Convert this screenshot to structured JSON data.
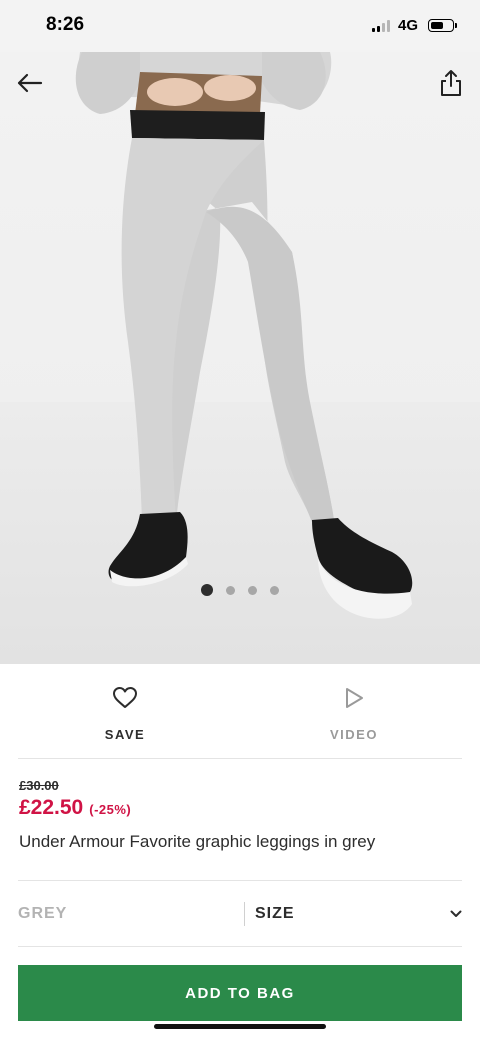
{
  "status_bar": {
    "time": "8:26",
    "network": "4G",
    "signal_bars_active": 2,
    "battery_level": 0.65
  },
  "hero": {
    "image_alt": "",
    "dots_count": 4,
    "active_dot": 1,
    "icons": {
      "back": "back-arrow-icon",
      "share": "share-icon"
    }
  },
  "actions": {
    "save_label": "SAVE",
    "video_label": "VIDEO",
    "icons": {
      "save": "heart-icon",
      "video": "play-icon"
    }
  },
  "product": {
    "old_price": "£30.00",
    "new_price": "£22.50",
    "discount": "(-25%)",
    "name": "Under Armour Favorite graphic leggings in grey"
  },
  "selectors": {
    "colour": "GREY",
    "size_label": "SIZE",
    "size_icon": "chevron-down-icon"
  },
  "cta": {
    "add_to_bag_label": "ADD TO BAG"
  },
  "colors": {
    "price_red": "#d01345",
    "button_green": "#2b8a4a",
    "text_dark": "#2d2d2d",
    "muted_grey": "#9a9a9a"
  }
}
